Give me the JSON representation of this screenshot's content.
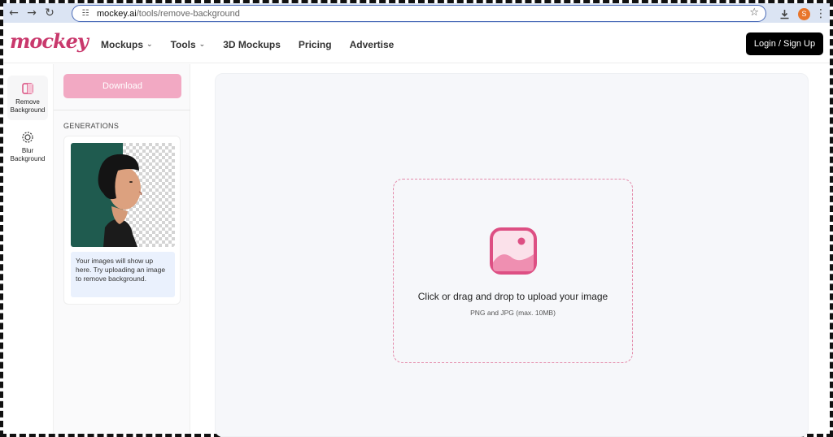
{
  "browser": {
    "back_icon": "arrow-left-icon",
    "url_host": "mockey.ai",
    "url_path": "/tools/remove-background",
    "profile_initial": "S"
  },
  "header": {
    "logo_text": "mockey",
    "nav": [
      {
        "label": "Mockups",
        "has_menu": true
      },
      {
        "label": "Tools",
        "has_menu": true
      },
      {
        "label": "3D Mockups",
        "has_menu": false
      },
      {
        "label": "Pricing",
        "has_menu": false
      },
      {
        "label": "Advertise",
        "has_menu": false
      }
    ],
    "login_label": "Login / Sign Up"
  },
  "rail": {
    "items": [
      {
        "line1": "Remove",
        "line2": "Background",
        "icon": "remove-background-icon",
        "active": true
      },
      {
        "line1": "Blur",
        "line2": "Background",
        "icon": "blur-background-icon",
        "active": false
      }
    ]
  },
  "panel": {
    "download_label": "Download",
    "generations_title": "GENERATIONS",
    "note": "Your images will show up here. Try uploading an image to remove background."
  },
  "upload": {
    "title": "Click or drag and drop to upload your image",
    "subtitle": "PNG and JPG (max. 10MB)"
  },
  "colors": {
    "brand": "#c9386c",
    "download_bg": "#f2a9c3",
    "dropzone_border": "#e48aaa",
    "login_bg": "#000000"
  }
}
